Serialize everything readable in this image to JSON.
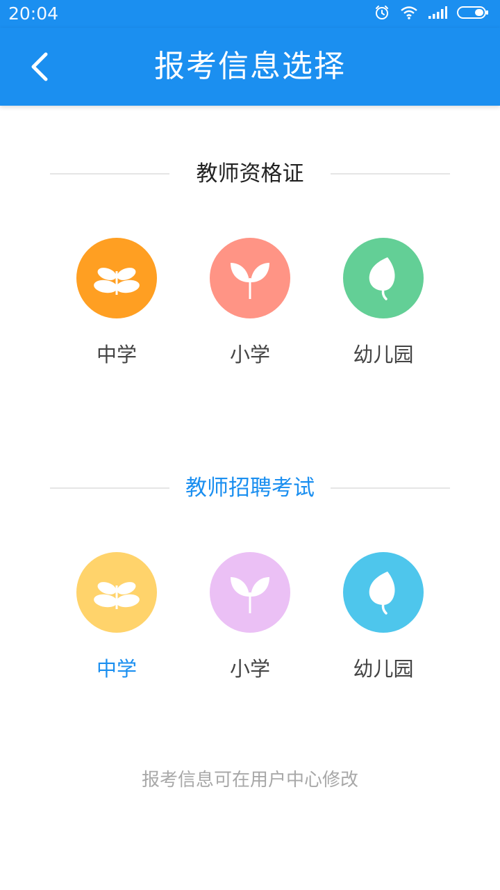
{
  "status_bar": {
    "time": "20:04",
    "icons": [
      "alarm-icon",
      "wifi-icon",
      "signal-icon",
      "battery-icon"
    ]
  },
  "header": {
    "title": "报考信息选择",
    "back_icon": "chevron-left-icon",
    "background": "#1b8ff0"
  },
  "sections": [
    {
      "title": "教师资格证",
      "title_color": "#222222",
      "options": [
        {
          "label": "中学",
          "icon": "sprout-round-icon",
          "color": "#ff9f22",
          "selected": false
        },
        {
          "label": "小学",
          "icon": "sprout-v-icon",
          "color": "#ff9485",
          "selected": false
        },
        {
          "label": "幼儿园",
          "icon": "leaf-icon",
          "color": "#63cf96",
          "selected": false
        }
      ]
    },
    {
      "title": "教师招聘考试",
      "title_color": "#1b8ff0",
      "options": [
        {
          "label": "中学",
          "icon": "sprout-round-icon",
          "color": "#ffd36b",
          "selected": true
        },
        {
          "label": "小学",
          "icon": "sprout-v-icon",
          "color": "#ebc0f5",
          "selected": false
        },
        {
          "label": "幼儿园",
          "icon": "leaf-icon",
          "color": "#4ec6ec",
          "selected": false
        }
      ]
    }
  ],
  "footer": {
    "note": "报考信息可在用户中心修改"
  }
}
